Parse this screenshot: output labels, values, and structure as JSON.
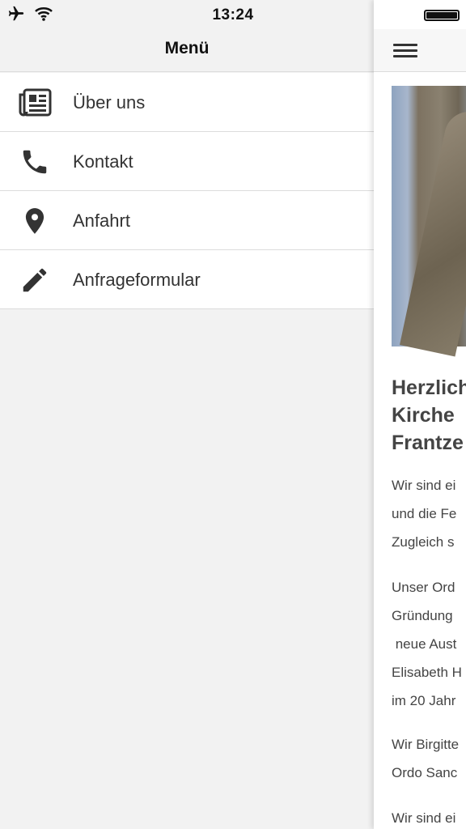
{
  "status_bar": {
    "time": "13:24",
    "icons": [
      "airplane-icon",
      "wifi-icon",
      "battery-icon"
    ]
  },
  "drawer": {
    "title": "Menü",
    "items": [
      {
        "label": "Über uns",
        "icon": "newspaper-icon"
      },
      {
        "label": "Kontakt",
        "icon": "phone-icon"
      },
      {
        "label": "Anfahrt",
        "icon": "map-pin-icon"
      },
      {
        "label": "Anfrageformular",
        "icon": "pencil-icon"
      }
    ]
  },
  "content": {
    "menu_icon": "hamburger-icon",
    "title_lines": [
      "Herzlich",
      "Kirche",
      "Frantze"
    ],
    "paragraph1": [
      "Wir sind ei",
      "und die Fe",
      "Zugleich s"
    ],
    "paragraph2": [
      "Unser Ord",
      "Gründung",
      " neue Aust",
      "Elisabeth H",
      "im 20 Jahr"
    ],
    "paragraph3": [
      "Wir Birgitte",
      "Ordo Sanc"
    ],
    "paragraph4": [
      "Wir sind ei"
    ]
  },
  "colors": {
    "background": "#f2f2f2",
    "list_background": "#ffffff",
    "divider": "#dcdcdc",
    "text": "#333333"
  }
}
